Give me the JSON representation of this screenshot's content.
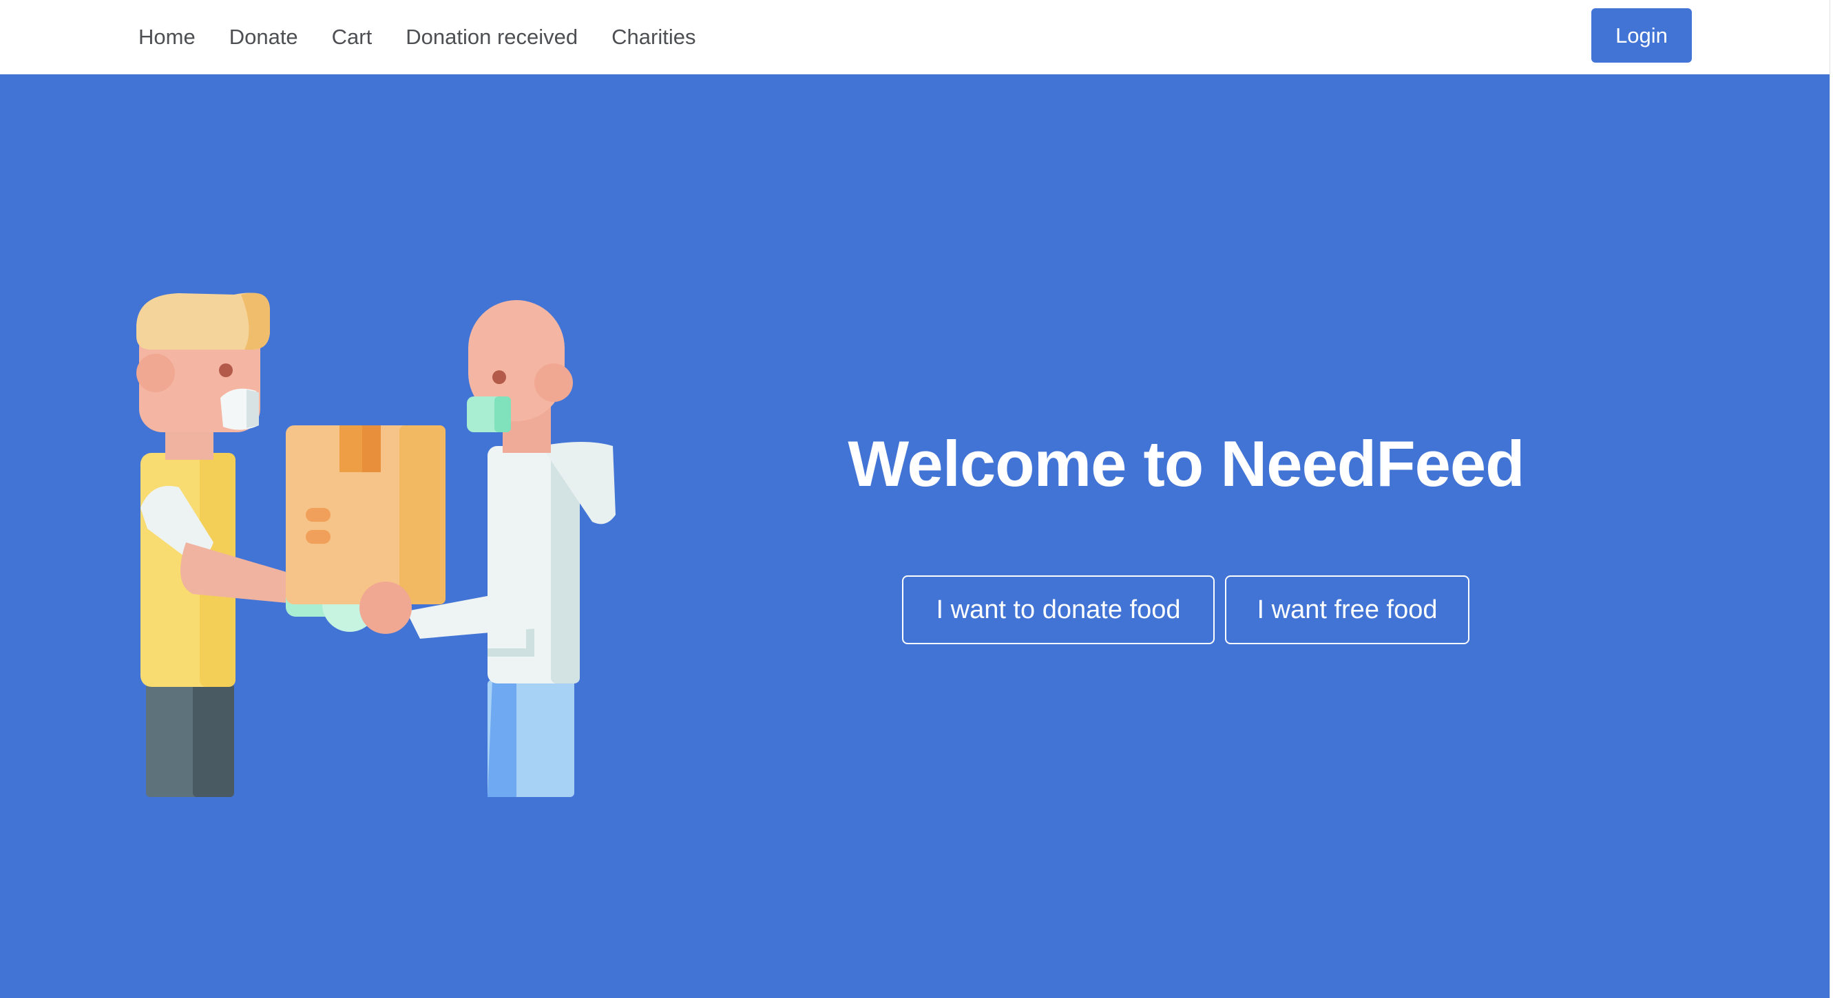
{
  "navbar": {
    "links": [
      {
        "label": "Home"
      },
      {
        "label": "Donate"
      },
      {
        "label": "Cart"
      },
      {
        "label": "Donation received"
      },
      {
        "label": "Charities"
      }
    ],
    "login_label": "Login"
  },
  "hero": {
    "title": "Welcome to NeedFeed",
    "buttons": {
      "donate_label": "I want to donate food",
      "free_label": "I want free food"
    },
    "illustration": "two-people-handing-over-food-box-illustration"
  },
  "colors": {
    "brand_blue": "#4274d6",
    "navbar_bg": "#ffffff",
    "nav_text": "#4d4f53",
    "hero_text": "#ffffff"
  }
}
